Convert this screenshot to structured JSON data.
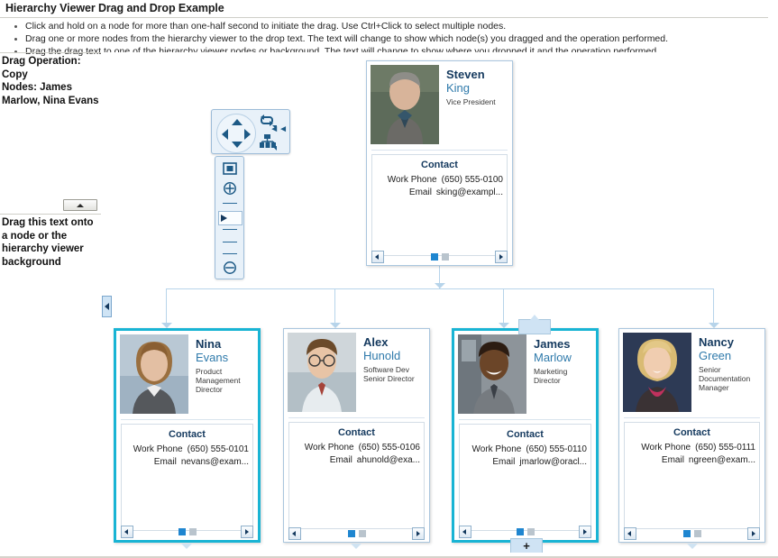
{
  "header": {
    "title": "Hierarchy Viewer Drag and Drop Example",
    "bullets": [
      "Click and hold on a node for more than one-half second to initiate the drag. Use Ctrl+Click to select multiple nodes.",
      "Drag one or more nodes from the hierarchy viewer to the drop text. The text will change to show which node(s) you dragged and the operation performed.",
      "Drag the drag text to one of the hierarchy viewer nodes or background. The text will change to show where you dropped it and the operation performed."
    ]
  },
  "sidebar": {
    "drop_status": "Drag Operation: Copy\nNodes: James Marlow, Nina Evans",
    "drag_source_text": "Drag this text onto a node or the hierarchy viewer background",
    "collapse_label": "collapse-pane"
  },
  "controls": {
    "pan_up": "pan-up",
    "pan_down": "pan-down",
    "pan_left": "pan-left",
    "pan_right": "pan-right",
    "layout_orientation": "layout-orientation",
    "layout_type": "layout-type",
    "collapse_panel": "collapse-panel",
    "fit_to_window": "fit-to-window",
    "zoom_in": "zoom-in",
    "zoom_out": "zoom-out",
    "zoom_slider": "zoom-slider"
  },
  "node_labels": {
    "contact_heading": "Contact",
    "work_phone_label": "Work Phone",
    "email_label": "Email",
    "prev": "previous-panel",
    "next": "next-panel"
  },
  "colors": {
    "selection": "#19b4d4",
    "node_border": "#aac6de",
    "connector": "#b7d4ea",
    "first_name": "#14395e",
    "last_name": "#2f7aab",
    "accent_dot": "#1f86d0"
  },
  "nodes": {
    "root": {
      "first_name": "Steven",
      "last_name": "King",
      "title": "Vice President",
      "phone": "(650) 555-0100",
      "email": "sking@exampl...",
      "selected": false,
      "expand_badge": null,
      "photo": "photo-steven-king"
    },
    "children": [
      {
        "first_name": "Nina",
        "last_name": "Evans",
        "title": "Product Management Director",
        "phone": "(650) 555-0101",
        "email": "nevans@exam...",
        "selected": true,
        "expand_badge": null,
        "photo": "photo-nina-evans"
      },
      {
        "first_name": "Alex",
        "last_name": "Hunold",
        "title": "Software Dev Senior Director",
        "phone": "(650) 555-0106",
        "email": "ahunold@exa...",
        "selected": false,
        "expand_badge": null,
        "photo": "photo-alex-hunold"
      },
      {
        "first_name": "James",
        "last_name": "Marlow",
        "title": "Marketing Director",
        "phone": "(650) 555-0110",
        "email": "jmarlow@oracl...",
        "selected": true,
        "expand_badge": "+",
        "photo": "photo-james-marlow"
      },
      {
        "first_name": "Nancy",
        "last_name": "Green",
        "title": "Senior Documentation Manager",
        "phone": "(650) 555-0111",
        "email": "ngreen@exam...",
        "selected": false,
        "expand_badge": null,
        "photo": "photo-nancy-green"
      }
    ]
  }
}
